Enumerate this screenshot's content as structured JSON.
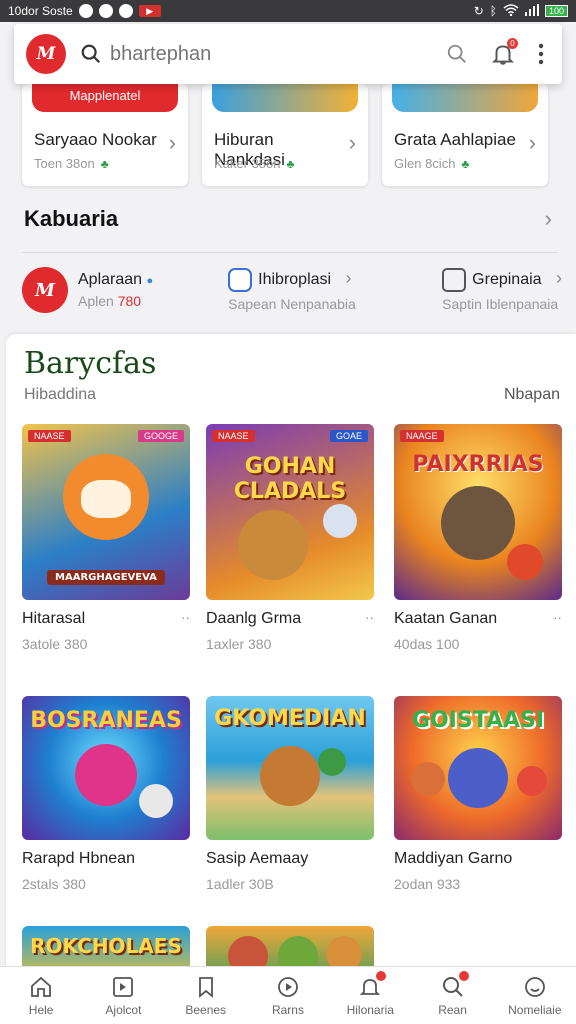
{
  "status": {
    "time": "10dor Soste",
    "battery": "100"
  },
  "search": {
    "logo": "M",
    "placeholder": "bhartephan"
  },
  "top_cards": [
    {
      "title": "Saryaao Nookar",
      "sub": "Toen 38on",
      "banner": "Mapplenatel"
    },
    {
      "title": "Hiburan Nankdasi",
      "sub": "Kaker 38on",
      "banner": ""
    },
    {
      "title": "Grata Aahlapiae",
      "sub": "Glen 8cich",
      "banner": ""
    }
  ],
  "section": {
    "title": "Kabuaria"
  },
  "apps": [
    {
      "name": "Aplaraan",
      "sub_prefix": "Aplen ",
      "sub_red": "780"
    },
    {
      "name": "Ihibroplasi",
      "sub": "Sapean Nenpanabia"
    },
    {
      "name": "Grepinaia",
      "sub": "Saptin Iblenpanaia"
    }
  ],
  "panel": {
    "title": "Barycfas",
    "subtitle": "Hibaddina",
    "link": "Nbapan"
  },
  "games": [
    {
      "title": "Hitarasal",
      "sub": "3atole 380",
      "tag": "NAASE",
      "tag2": "GOOGE",
      "art": "MAARGHAGEVEVA",
      "c1": "#f2a23a",
      "c2": "#c5481e"
    },
    {
      "title": "Daanlg Grma",
      "sub": "1axler 380",
      "tag": "NAASE",
      "tag2": "GOAE",
      "art": "GOHAN CLADALS",
      "c1": "#7f3bb0",
      "c2": "#f09a2a"
    },
    {
      "title": "Kaatan Ganan",
      "sub": "40das 100",
      "tag": "NAAGE",
      "tag2": "",
      "art": "PAIXRRIAS",
      "c1": "#f5b326",
      "c2": "#6a2e8c"
    },
    {
      "title": "Rarapd Hbnean",
      "sub": "2stals 380",
      "tag": "",
      "tag2": "",
      "art": "BOSRANEAS",
      "c1": "#26a7d8",
      "c2": "#7b2fa6"
    },
    {
      "title": "Sasip Aemaay",
      "sub": "1adler 30B",
      "tag": "",
      "tag2": "",
      "art": "GKOMEDIAN",
      "c1": "#4cb7e0",
      "c2": "#e0b34a"
    },
    {
      "title": "Maddiyan Garno",
      "sub": "2odan 933",
      "tag": "",
      "tag2": "",
      "art": "GOISTAASI",
      "c1": "#e3582a",
      "c2": "#f4c12f"
    }
  ],
  "bottom_games": [
    {
      "art": "ROKCHOLAES",
      "c1": "#2aa0d8",
      "c2": "#f1c22e"
    },
    {
      "art": "",
      "c1": "#f0a73b",
      "c2": "#3f9d5a"
    }
  ],
  "nav": [
    {
      "label": "Hele",
      "icon": "home-icon"
    },
    {
      "label": "Ajolcot",
      "icon": "apps-icon"
    },
    {
      "label": "Beenes",
      "icon": "bookmark-icon"
    },
    {
      "label": "Rarns",
      "icon": "play-icon"
    },
    {
      "label": "Hilonaria",
      "icon": "bell-icon"
    },
    {
      "label": "Rean",
      "icon": "search-icon"
    },
    {
      "label": "Nomeliaie",
      "icon": "smile-icon"
    }
  ],
  "colors": {
    "brand_red": "#e02a2d",
    "green": "#2e9e4d"
  }
}
